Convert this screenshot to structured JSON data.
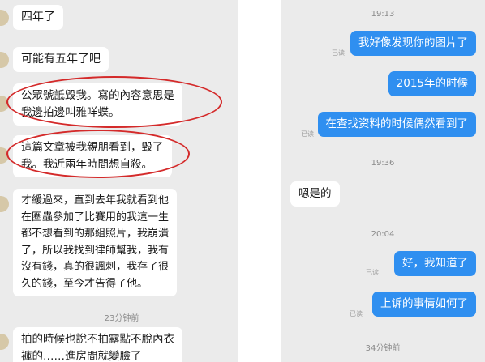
{
  "left_chat": {
    "messages": [
      "四年了",
      "可能有五年了吧",
      "公眾號詆毀我。寫的內容意思是\n我邊拍邊叫雅咩蝶。",
      "這篇文章被我親朋看到，毀了\n我。我近兩年時間想自殺。",
      "才緩過來，直到去年我就看到他\n在圈蟲參加了比賽用的我這一生\n都不想看到的那組照片，我崩潰\n了，所以我找到律師幫我，我有\n沒有錢，真的很諷刺，我存了很\n久的錢，至今才告得了他。",
      "拍的時候也說不拍露點不脫內衣\n褲的……進房間就變臉了"
    ],
    "timestamp": "23分钟前"
  },
  "right_chat": {
    "times": [
      "19:13",
      "19:36",
      "20:04",
      "34分钟前"
    ],
    "read_label": "已读",
    "outgoing": [
      "我好像发现你的图片了",
      "2015年的时候",
      "在查找资料的时候偶然看到了",
      "好，我知道了",
      "上诉的事情如何了"
    ],
    "incoming": [
      "嗯是的"
    ]
  },
  "colors": {
    "chat_bg": "#ebebeb",
    "incoming_bubble": "#ffffff",
    "outgoing_bubble": "#2f8ff0",
    "highlight_circle": "#d42a2a"
  }
}
